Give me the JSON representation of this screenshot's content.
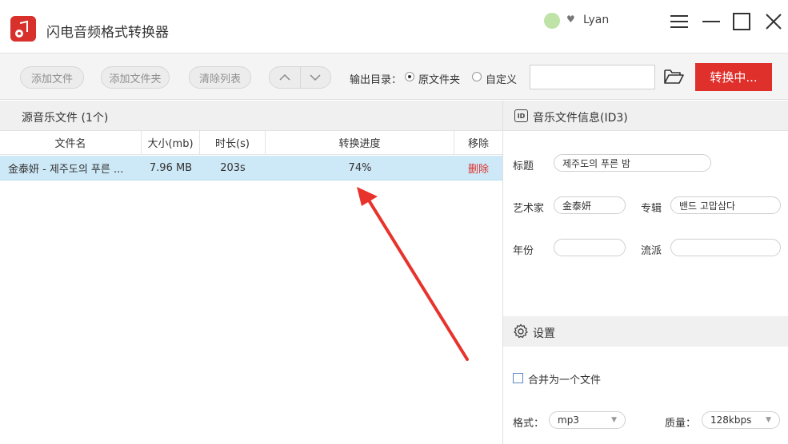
{
  "app": {
    "title": "闪电音频格式转换器",
    "user": "Lyan"
  },
  "toolbar": {
    "add_file": "添加文件",
    "add_folder": "添加文件夹",
    "clear_list": "清除列表",
    "output_label": "输出目录：",
    "option_original": "原文件夹",
    "option_custom": "自定义",
    "output_path_value": "",
    "convert_label": "转换中..."
  },
  "file_list": {
    "header": "源音乐文件 (1个)",
    "columns": [
      "文件名",
      "大小(mb)",
      "时长(s)",
      "转换进度",
      "移除"
    ],
    "rows": [
      {
        "name": "金泰妍 - 제주도의 푸른 ...",
        "size": "7.96 MB",
        "duration": "203s",
        "progress": "74%",
        "remove": "删除"
      }
    ]
  },
  "info": {
    "header": "音乐文件信息(ID3)",
    "id3_badge": "ID",
    "title_label": "标题",
    "title_value": "제주도의 푸른 밤",
    "artist_label": "艺术家",
    "artist_value": "金泰妍",
    "album_label": "专辑",
    "album_value": "밴드 고맙삼다",
    "year_label": "年份",
    "year_value": "",
    "genre_label": "流派",
    "genre_value": ""
  },
  "settings": {
    "header": "设置",
    "merge_label": "合并为一个文件",
    "merge_checked": false,
    "format_label": "格式：",
    "format_value": "mp3",
    "quality_label": "质量：",
    "quality_value": "128kbps"
  },
  "colors": {
    "accent": "#e0302c",
    "row_selected": "#cde8f6",
    "panel_header": "#f0f0f0"
  }
}
